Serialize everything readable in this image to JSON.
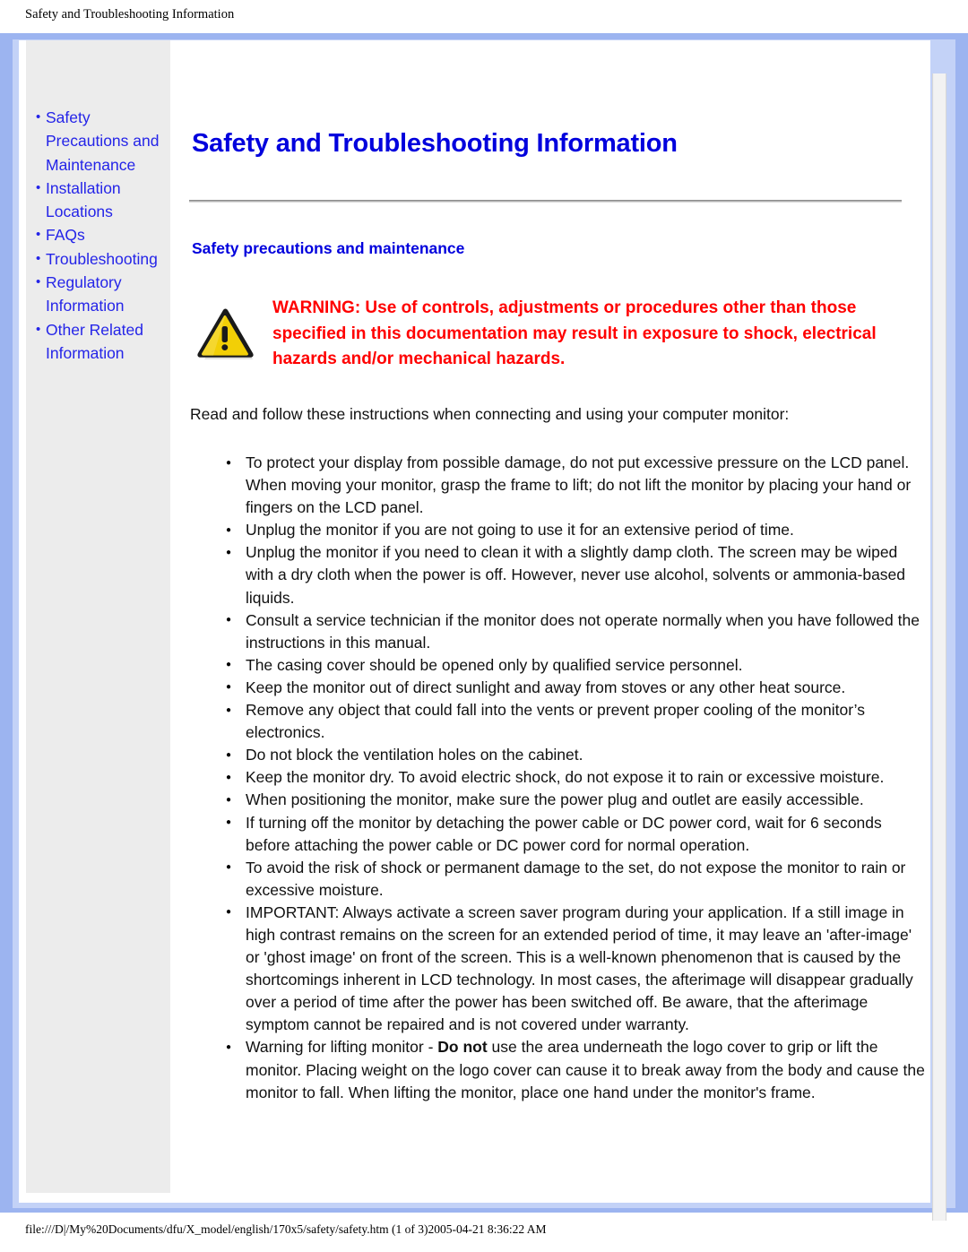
{
  "print_header": {
    "text": "Safety and Troubleshooting Information"
  },
  "print_footer": {
    "text": "file:///D|/My%20Documents/dfu/X_model/english/170x5/safety/safety.htm (1 of 3)2005-04-21 8:36:22 AM"
  },
  "colors": {
    "frame_blue": "#9cb4f0",
    "frame_light_blue": "#c3d2f7",
    "sidebar_bg": "#ececec",
    "link_blue": "#2424e8",
    "heading_blue": "#0000dd",
    "warning_red": "#ff0000",
    "warning_icon_fill": "#f5d300",
    "warning_icon_stroke": "#111111"
  },
  "sidebar": {
    "items": [
      {
        "label": "Safety Precautions and Maintenance",
        "nowrap": false
      },
      {
        "label": "Installation Locations",
        "nowrap": false
      },
      {
        "label": "FAQs",
        "nowrap": false
      },
      {
        "label": "Troubleshooting",
        "nowrap": true
      },
      {
        "label": "Regulatory Information",
        "nowrap": false
      },
      {
        "label": "Other Related Information",
        "nowrap": false
      }
    ]
  },
  "content": {
    "page_title": "Safety and Troubleshooting Information",
    "section_heading": "Safety precautions and maintenance",
    "warning_icon_name": "warning-triangle-icon",
    "warning_text": "WARNING: Use of controls, adjustments or procedures other than those specified in this documentation may result in exposure to shock, electrical hazards and/or mechanical hazards.",
    "intro_paragraph": "Read and follow these instructions when connecting and using your computer monitor:",
    "bullets": [
      {
        "text": "To protect your display from possible damage, do not put excessive pressure on the LCD panel. When moving your monitor, grasp the frame to lift; do not lift the monitor by placing your hand or fingers on the LCD panel."
      },
      {
        "text": "Unplug the monitor if you are not going to use it for an extensive period of time."
      },
      {
        "text": "Unplug the monitor if you need to clean it with a slightly damp cloth. The screen may be wiped with a dry cloth when the power is off. However, never use alcohol, solvents or ammonia-based liquids."
      },
      {
        "text": "Consult a service technician if the monitor does not operate normally when you have followed the instructions in this manual."
      },
      {
        "text": "The casing cover should be opened only by qualified service personnel."
      },
      {
        "text": "Keep the monitor out of direct sunlight and away from stoves or any other heat source."
      },
      {
        "text": "Remove any object that could fall into the vents or prevent proper cooling of the monitor’s electronics."
      },
      {
        "text": "Do not block the ventilation holes on the cabinet."
      },
      {
        "text": "Keep the monitor dry. To avoid electric shock, do not expose it to rain or excessive moisture."
      },
      {
        "text": "When positioning the monitor, make sure the power plug and outlet are easily accessible."
      },
      {
        "text": "If turning off the monitor by detaching the power cable or DC power cord, wait for 6 seconds before attaching the power cable or DC power cord for normal operation."
      },
      {
        "text": "To avoid the risk of shock or permanent damage to the set, do not expose the monitor to rain or excessive moisture."
      },
      {
        "text": "IMPORTANT: Always activate a screen saver program during your application. If a still image in high contrast remains on the screen for an extended period of time, it may leave an 'after-image' or 'ghost image' on front of the screen. This is a well-known phenomenon that is caused by the shortcomings inherent in LCD technology. In most cases, the afterimage will disappear gradually over a period of time after the power has been switched off. Be aware, that the afterimage symptom cannot be repaired and is not covered under warranty."
      },
      {
        "prefix": "Warning for lifting monitor - ",
        "bold": "Do not",
        "suffix": " use the area underneath the logo cover to grip or lift the monitor. Placing weight on the logo cover can cause it to break away from the body and cause the monitor to fall. When lifting the monitor, place one hand under the monitor's frame."
      }
    ]
  }
}
